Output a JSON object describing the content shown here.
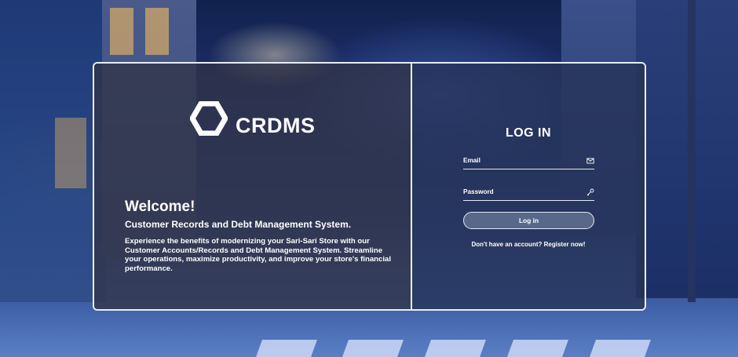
{
  "brand": {
    "name": "CRDMS",
    "logo_icon": "hexagon-logo-icon"
  },
  "welcome": {
    "heading": "Welcome!",
    "subtitle": "Customer Records and Debt Management System.",
    "description": "Experience the benefits of modernizing your Sari-Sari Store with our Customer Accounts/Records and Debt Management System. Streamline your operations, maximize productivity, and improve your store's financial performance."
  },
  "login": {
    "title": "LOG IN",
    "email_label": "Email",
    "email_value": "",
    "email_icon": "envelope-icon",
    "password_label": "Password",
    "password_value": "",
    "password_icon": "key-icon",
    "button_label": "Log in",
    "register_prompt": "Don't have an account?",
    "register_link": "Register now!"
  },
  "colors": {
    "card_border": "#e8ecf5",
    "button_fill": "#8291af",
    "text": "#ffffff"
  }
}
